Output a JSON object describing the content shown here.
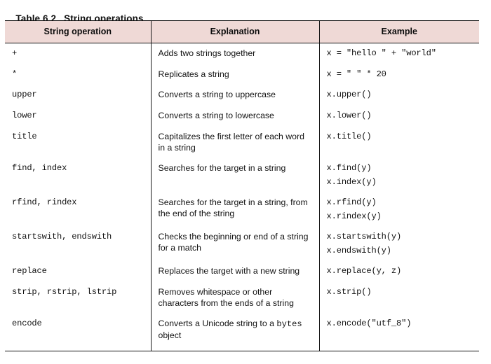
{
  "caption": {
    "number": "Table 6.2",
    "title": "String operations"
  },
  "table": {
    "headers": {
      "operation": "String operation",
      "explanation": "Explanation",
      "example": "Example"
    },
    "header_bg": "#efd9d6",
    "rule_color": "#101010",
    "rows": [
      {
        "operation": "+",
        "explanation": "Adds two strings together",
        "examples": [
          "x = \"hello \" + \"world\""
        ]
      },
      {
        "operation": "*",
        "explanation": "Replicates a string",
        "examples": [
          "x = \" \" * 20"
        ]
      },
      {
        "operation": "upper",
        "explanation": "Converts a string to uppercase",
        "examples": [
          "x.upper()"
        ]
      },
      {
        "operation": "lower",
        "explanation": "Converts a string to lowercase",
        "examples": [
          "x.lower()"
        ]
      },
      {
        "operation": "title",
        "explanation": "Capitalizes the first letter of each word in a string",
        "examples": [
          "x.title()"
        ]
      },
      {
        "operation": "find, index",
        "explanation": "Searches for the target in a string",
        "examples": [
          "x.find(y)",
          "x.index(y)"
        ]
      },
      {
        "operation": "rfind, rindex",
        "explanation": "Searches for the target in a string, from the end of the string",
        "examples": [
          "x.rfind(y)",
          "x.rindex(y)"
        ]
      },
      {
        "operation": "startswith, endswith",
        "explanation": "Checks the beginning or end of a string for a match",
        "examples": [
          "x.startswith(y)",
          "x.endswith(y)"
        ]
      },
      {
        "operation": "replace",
        "explanation": "Replaces the target with a new string",
        "examples": [
          "x.replace(y, z)"
        ]
      },
      {
        "operation": "strip, rstrip, lstrip",
        "explanation": "Removes whitespace or other characters from the ends of a string",
        "examples": [
          "x.strip()"
        ]
      },
      {
        "operation": "encode",
        "explanation_prefix": "Converts a Unicode string to a ",
        "explanation_code": "bytes",
        "explanation_suffix": " object",
        "explanation": "Converts a Unicode string to a bytes object",
        "examples": [
          "x.encode(\"utf_8\")"
        ]
      }
    ]
  }
}
